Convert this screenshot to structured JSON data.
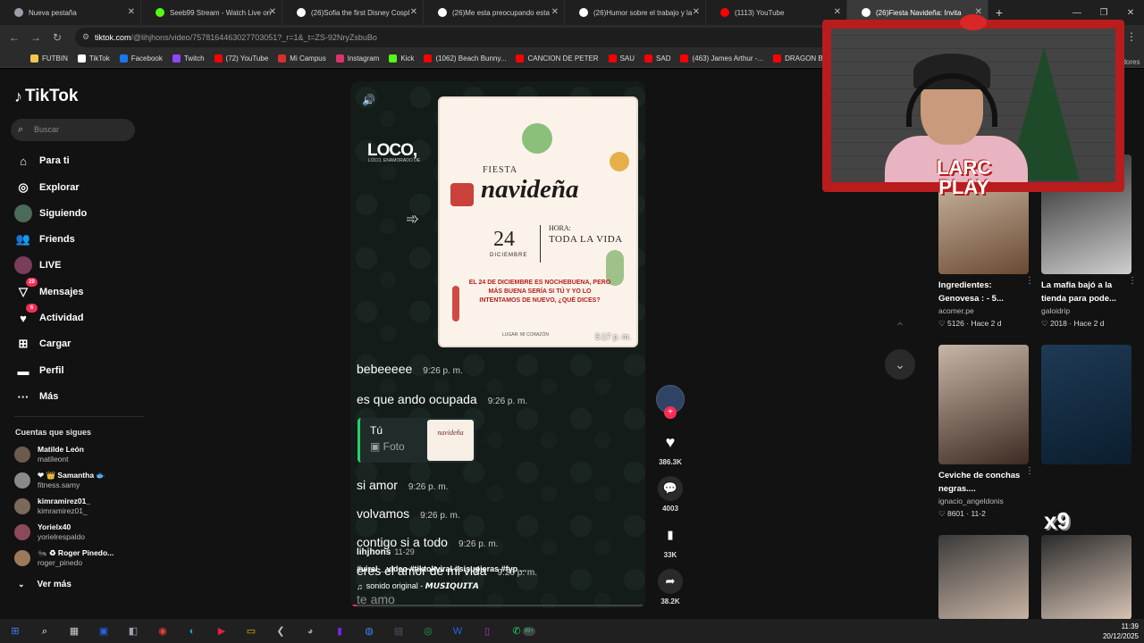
{
  "browser": {
    "tabs": [
      {
        "title": "Nueva pestaña",
        "color": "#9aa0a6",
        "active": false
      },
      {
        "title": "Seeb99 Stream - Watch Live on",
        "color": "#53fc18",
        "active": false
      },
      {
        "title": "(26)Sofia the first Disney Cospl",
        "color": "#ffffff",
        "active": false
      },
      {
        "title": "(26)Me esta preocupando esta",
        "color": "#ffffff",
        "active": false
      },
      {
        "title": "(26)Humor sobre el trabajo y la",
        "color": "#ffffff",
        "active": false
      },
      {
        "title": "(1113) YouTube",
        "color": "#ff0000",
        "active": false
      },
      {
        "title": "(26)Fiesta Navideña: Invita",
        "color": "#ffffff",
        "active": true
      }
    ],
    "url_host": "tiktok.com",
    "url_rest": "/@lihjhons/video/7578164463027703051?_r=1&_t=ZS-92NryZsbuBo",
    "bookmarks": [
      {
        "label": "FUTBIN",
        "color": "#f2c84b"
      },
      {
        "label": "TikTok",
        "color": "#ffffff"
      },
      {
        "label": "Facebook",
        "color": "#1877f2"
      },
      {
        "label": "Twitch",
        "color": "#9146ff"
      },
      {
        "label": "(72) YouTube",
        "color": "#ff0000"
      },
      {
        "label": "Mi Campus",
        "color": "#d9302c"
      },
      {
        "label": "Instagram",
        "color": "#e1306c"
      },
      {
        "label": "Kick",
        "color": "#53fc18"
      },
      {
        "label": "(1062) Beach Bunny...",
        "color": "#ff0000"
      },
      {
        "label": "CANCION DE PETER",
        "color": "#ff0000"
      },
      {
        "label": "SAU",
        "color": "#ff0000"
      },
      {
        "label": "SAD",
        "color": "#ff0000"
      },
      {
        "label": "(463) James Arthur -...",
        "color": "#ff0000"
      },
      {
        "label": "DRAGON B",
        "color": "#ff0000"
      }
    ]
  },
  "sidebar": {
    "brand": "TikTok",
    "search_placeholder": "Buscar",
    "nav": [
      {
        "label": "Para ti",
        "icon": "home-icon",
        "glyph": "⌂"
      },
      {
        "label": "Explorar",
        "icon": "compass-icon",
        "glyph": "◎"
      },
      {
        "label": "Siguiendo",
        "icon": "following-avatar-icon",
        "glyph": "●"
      },
      {
        "label": "Friends",
        "icon": "friends-icon",
        "glyph": "👥"
      },
      {
        "label": "LIVE",
        "icon": "live-avatar-icon",
        "glyph": "●"
      },
      {
        "label": "Mensajes",
        "icon": "messages-icon",
        "glyph": "▽",
        "badge": "20"
      },
      {
        "label": "Actividad",
        "icon": "activity-icon",
        "glyph": "♥",
        "badge": "6"
      },
      {
        "label": "Cargar",
        "icon": "upload-icon",
        "glyph": "⊞"
      },
      {
        "label": "Perfil",
        "icon": "profile-icon",
        "glyph": "▬"
      },
      {
        "label": "Más",
        "icon": "more-icon",
        "glyph": "···"
      }
    ],
    "following_title": "Cuentas que sigues",
    "accounts": [
      {
        "name": "Matilde León",
        "handle": "matileont"
      },
      {
        "name": "❤ 👑 Samantha 🐟",
        "handle": "fitness.samy"
      },
      {
        "name": "kimramirez01_",
        "handle": "kimramirez01_"
      },
      {
        "name": "Yorielx40",
        "handle": "yorielrespaldo"
      },
      {
        "name": "🐜 ♻ Roger Pinedo...",
        "handle": "roger_pinedo"
      }
    ],
    "see_more": "Ver más"
  },
  "video": {
    "overlay_brand": "LOCO,",
    "overlay_sub": "LOCO, ENAMORADO DE",
    "invite": {
      "line1": "FIESTA",
      "line2": "navideña",
      "day": "24",
      "month": "DICIEMBRE",
      "hora_label": "HORA:",
      "hora_value": "TODA LA VIDA",
      "message": "EL 24 DE DICIEMBRE ES NOCHEBUENA, PERO MÁS BUENA SERÍA SI TÚ Y YO LO INTENTAMOS DE NUEVO, ¿QUÉ DICES?",
      "footer": "LUGAR: MI CORAZÓN",
      "time": "5:17 p. m."
    },
    "messages": [
      {
        "text": "bebeeeee",
        "time": "9:26 p. m."
      },
      {
        "text": "es que ando ocupada",
        "time": "9:26 p. m."
      },
      {
        "text": "si amor",
        "time": "9:26 p. m."
      },
      {
        "text": "volvamos",
        "time": "9:26 p. m."
      },
      {
        "text": "contigo si a todo",
        "time": "9:26 p. m."
      },
      {
        "text": "eres el amor de mi vida",
        "time": "9:26 p. m."
      },
      {
        "text": "te amo",
        "time": ""
      }
    ],
    "reply": {
      "who": "Tú",
      "what": "Foto",
      "thumb_text": "navideña"
    },
    "author": "lihjhons",
    "author_date": "11-29",
    "hashtags": "#viral__video #tiktokviral #sisupieras #fyp ...",
    "sound": "sonido original - 𝙈𝙐𝙎𝙄𝙌𝙐𝙄𝙏𝘼",
    "progress": 0.02
  },
  "actions": [
    {
      "icon": "heart-icon",
      "glyph": "♥",
      "count": "386.3K"
    },
    {
      "icon": "comment-icon",
      "glyph": "💬",
      "count": "4003"
    },
    {
      "icon": "bookmark-icon",
      "glyph": "▮",
      "count": "33K"
    },
    {
      "icon": "share-icon",
      "glyph": "➦",
      "count": "38.2K"
    }
  ],
  "grid": [
    {
      "title": "Ingredientes: Genovesa : - 5...",
      "source": "acomer.pe",
      "meta": "♡ 5126 · Hace 2 d",
      "color1": "#6a4a33",
      "color2": "#d9c8b2"
    },
    {
      "title": "La mafia bajó a la tienda para pode...",
      "source": "galoidrip",
      "meta": "♡ 2018 · Hace 2 d",
      "color1": "#cfcfcf",
      "color2": "#222222"
    },
    {
      "title": "Ceviche de conchas negras....",
      "source": "ignacio_angeldonis",
      "meta": "♡ 8601 · 11-2",
      "color1": "#3d2a22",
      "color2": "#c7b6a7"
    },
    {
      "title": "",
      "source": "",
      "meta": "",
      "color1": "#0b1d2e",
      "color2": "#1e3a55"
    },
    {
      "title": "",
      "source": "",
      "meta": "",
      "color1": "#c9b4a4",
      "color2": "#3a3a3a"
    },
    {
      "title": "",
      "source": "",
      "meta": "",
      "color1": "#d7c3b5",
      "color2": "#2b2b2b"
    }
  ],
  "grid_side_text": "adores",
  "cam": {
    "logo": "LARC\nPLAY",
    "brand_mark": "LARC",
    "x9": "x9"
  },
  "taskbar": {
    "icons": [
      "windows-icon",
      "search-icon",
      "task-view-icon",
      "store-icon",
      "app-icon",
      "chrome-icon",
      "edge-icon",
      "app2-icon",
      "folder-icon",
      "app3-icon",
      "app4-icon",
      "app5-icon",
      "app6-icon",
      "calculator-icon",
      "app7-icon",
      "word-icon",
      "app8-icon",
      "whatsapp-icon"
    ],
    "whatsapp_badge": "99+",
    "time": "11:39",
    "date": "20/12/2025"
  }
}
